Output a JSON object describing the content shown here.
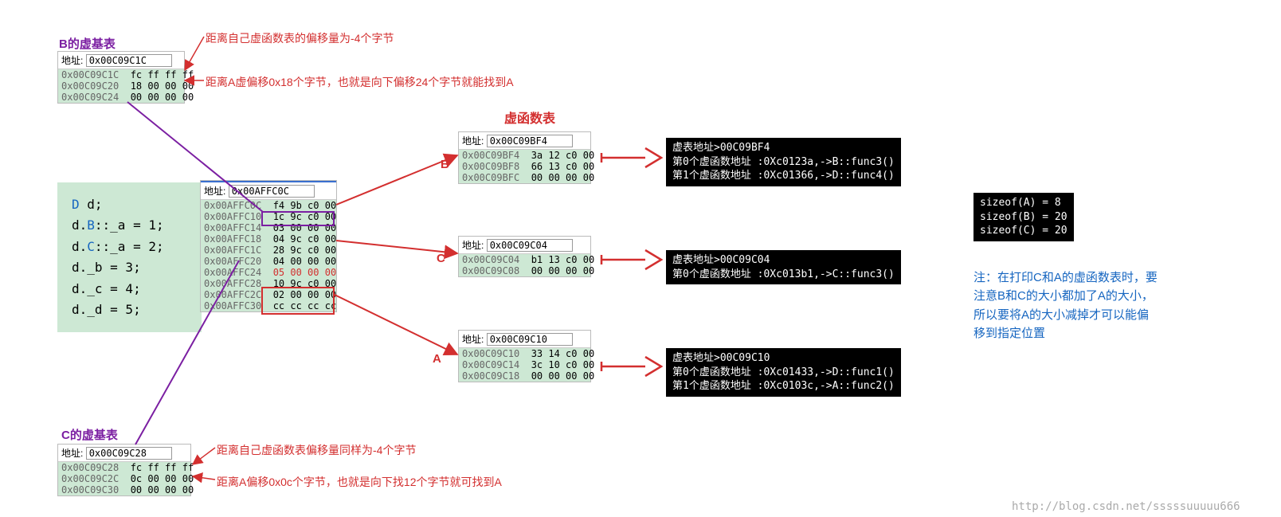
{
  "titles": {
    "b_vbase": "B的虚基表",
    "c_vbase": "C的虚基表",
    "vftable": "虚函数表"
  },
  "addr_label": "地址:",
  "b_vbase": {
    "addr": "0x00C09C1C",
    "rows": [
      {
        "a": "0x00C09C1C",
        "b": "fc ff ff ff"
      },
      {
        "a": "0x00C09C20",
        "b": "18 00 00 00"
      },
      {
        "a": "0x00C09C24",
        "b": "00 00 00 00"
      }
    ]
  },
  "c_vbase": {
    "addr": "0x00C09C28",
    "rows": [
      {
        "a": "0x00C09C28",
        "b": "fc ff ff ff"
      },
      {
        "a": "0x00C09C2C",
        "b": "0c 00 00 00"
      },
      {
        "a": "0x00C09C30",
        "b": "00 00 00 00"
      }
    ]
  },
  "code": {
    "l1a": "D",
    "l1b": " d;",
    "l2a": "d.",
    "l2b": "B",
    "l2c": "::_a = 1;",
    "l3a": "d.",
    "l3b": "C",
    "l3c": "::_a = 2;",
    "l4": "d._b = 3;",
    "l5": "d._c = 4;",
    "l6": "d._d = 5;"
  },
  "main": {
    "addr": "0x00AFFC0C",
    "rows": [
      {
        "a": "0x00AFFC0C",
        "b": "f4 9b c0 00"
      },
      {
        "a": "0x00AFFC10",
        "b": "1c 9c c0 00"
      },
      {
        "a": "0x00AFFC14",
        "b": "03 00 00 00"
      },
      {
        "a": "0x00AFFC18",
        "b": "04 9c c0 00"
      },
      {
        "a": "0x00AFFC1C",
        "b": "28 9c c0 00"
      },
      {
        "a": "0x00AFFC20",
        "b": "04 00 00 00"
      },
      {
        "a": "0x00AFFC24",
        "b": "05 00 00 00",
        "red": true
      },
      {
        "a": "0x00AFFC28",
        "b": "10 9c c0 00"
      },
      {
        "a": "0x00AFFC2C",
        "b": "02 00 00 00"
      },
      {
        "a": "0x00AFFC30",
        "b": "cc cc cc cc"
      }
    ]
  },
  "vft_b": {
    "addr": "0x00C09BF4",
    "rows": [
      {
        "a": "0x00C09BF4",
        "b": "3a 12 c0 00"
      },
      {
        "a": "0x00C09BF8",
        "b": "66 13 c0 00"
      },
      {
        "a": "0x00C09BFC",
        "b": "00 00 00 00"
      }
    ]
  },
  "vft_c": {
    "addr": "0x00C09C04",
    "rows": [
      {
        "a": "0x00C09C04",
        "b": "b1 13 c0 00"
      },
      {
        "a": "0x00C09C08",
        "b": "00 00 00 00"
      }
    ]
  },
  "vft_a": {
    "addr": "0x00C09C10",
    "rows": [
      {
        "a": "0x00C09C10",
        "b": "33 14 c0 00"
      },
      {
        "a": "0x00C09C14",
        "b": "3c 10 c0 00"
      },
      {
        "a": "0x00C09C18",
        "b": "00 00 00 00"
      }
    ]
  },
  "labels": {
    "b": "B",
    "c": "C",
    "a": "A"
  },
  "console_b": "虚表地址>00C09BF4\n第0个虚函数地址 :0Xc0123a,->B::func3()\n第1个虚函数地址 :0Xc01366,->D::func4()",
  "console_c": "虚表地址>00C09C04\n第0个虚函数地址 :0Xc013b1,->C::func3()",
  "console_a": "虚表地址>00C09C10\n第0个虚函数地址 :0Xc01433,->D::func1()\n第1个虚函数地址 :0Xc0103c,->A::func2()",
  "sizeof": "sizeof(A) = 8\nsizeof(B) = 20\nsizeof(C) = 20",
  "notes": {
    "n1": "距离自己虚函数表的偏移量为-4个字节",
    "n2": "距离A虚偏移0x18个字节，也就是向下偏移24个字节就能找到A",
    "n3": "距离自己虚函数表偏移量同样为-4个字节",
    "n4": "距离A偏移0x0c个字节，也就是向下找12个字节就可找到A",
    "blue": "注：在打印C和A的虚函数表时，要\n注意B和C的大小都加了A的大小，\n所以要将A的大小减掉才可以能偏\n移到指定位置"
  },
  "watermark": "http://blog.csdn.net/sssssuuuuu666"
}
